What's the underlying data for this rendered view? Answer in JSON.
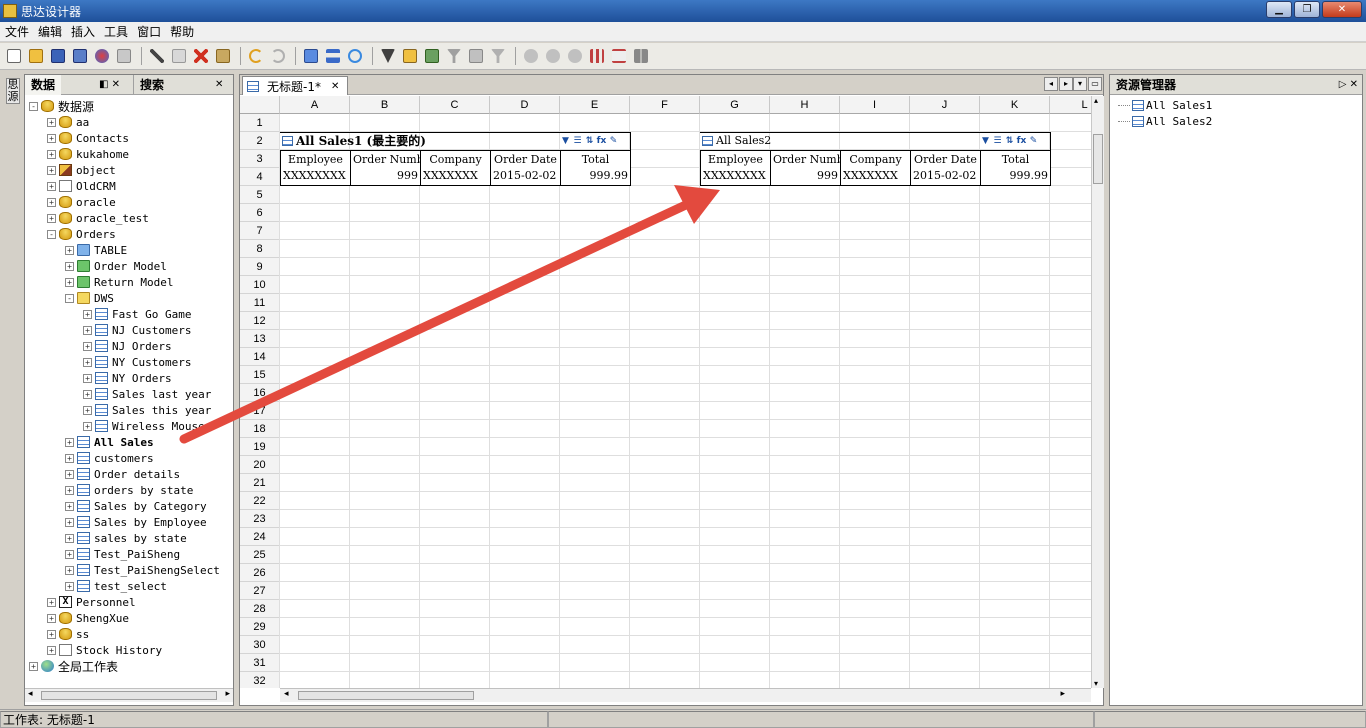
{
  "window": {
    "title": "思达设计器"
  },
  "menu": [
    "文件",
    "编辑",
    "插入",
    "工具",
    "窗口",
    "帮助"
  ],
  "left_vertical_tab": "思源",
  "left_panel": {
    "tabs": [
      "数据",
      "搜索"
    ],
    "tree": [
      {
        "label": "数据源",
        "depth": 0,
        "icon": "db",
        "exp": "-"
      },
      {
        "label": "aa",
        "depth": 1,
        "icon": "db",
        "exp": "+"
      },
      {
        "label": "Contacts",
        "depth": 1,
        "icon": "db",
        "exp": "+"
      },
      {
        "label": "kukahome",
        "depth": 1,
        "icon": "db",
        "exp": "+"
      },
      {
        "label": "object",
        "depth": 1,
        "icon": "obj",
        "exp": "+"
      },
      {
        "label": "OldCRM",
        "depth": 1,
        "icon": "crm",
        "exp": "+"
      },
      {
        "label": "oracle",
        "depth": 1,
        "icon": "db",
        "exp": "+"
      },
      {
        "label": "oracle_test",
        "depth": 1,
        "icon": "db",
        "exp": "+"
      },
      {
        "label": "Orders",
        "depth": 1,
        "icon": "db",
        "exp": "-"
      },
      {
        "label": "TABLE",
        "depth": 2,
        "icon": "folder blue",
        "exp": "+"
      },
      {
        "label": "Order Model",
        "depth": 2,
        "icon": "folder green",
        "exp": "+"
      },
      {
        "label": "Return Model",
        "depth": 2,
        "icon": "folder green",
        "exp": "+"
      },
      {
        "label": "DWS",
        "depth": 2,
        "icon": "folder",
        "exp": "-"
      },
      {
        "label": "Fast Go Game",
        "depth": 3,
        "icon": "table",
        "exp": "+"
      },
      {
        "label": "NJ Customers",
        "depth": 3,
        "icon": "table",
        "exp": "+"
      },
      {
        "label": "NJ Orders",
        "depth": 3,
        "icon": "table",
        "exp": "+"
      },
      {
        "label": "NY Customers",
        "depth": 3,
        "icon": "table",
        "exp": "+"
      },
      {
        "label": "NY Orders",
        "depth": 3,
        "icon": "table",
        "exp": "+"
      },
      {
        "label": "Sales last year",
        "depth": 3,
        "icon": "table",
        "exp": "+"
      },
      {
        "label": "Sales this year",
        "depth": 3,
        "icon": "table",
        "exp": "+"
      },
      {
        "label": "Wireless Mouse",
        "depth": 3,
        "icon": "table",
        "exp": "+"
      },
      {
        "label": "All Sales",
        "depth": 2,
        "icon": "table",
        "exp": "+",
        "bold": true
      },
      {
        "label": "customers",
        "depth": 2,
        "icon": "table",
        "exp": "+"
      },
      {
        "label": "Order details",
        "depth": 2,
        "icon": "table",
        "exp": "+"
      },
      {
        "label": "orders by state",
        "depth": 2,
        "icon": "table",
        "exp": "+"
      },
      {
        "label": "Sales by Category",
        "depth": 2,
        "icon": "table",
        "exp": "+"
      },
      {
        "label": "Sales by Employee",
        "depth": 2,
        "icon": "table",
        "exp": "+"
      },
      {
        "label": "sales by state",
        "depth": 2,
        "icon": "table",
        "exp": "+"
      },
      {
        "label": "Test_PaiSheng",
        "depth": 2,
        "icon": "table",
        "exp": "+"
      },
      {
        "label": "Test_PaiShengSelect",
        "depth": 2,
        "icon": "table",
        "exp": "+"
      },
      {
        "label": "test_select",
        "depth": 2,
        "icon": "table",
        "exp": "+"
      },
      {
        "label": "Personnel",
        "depth": 1,
        "icon": "excel",
        "exp": "+"
      },
      {
        "label": "ShengXue",
        "depth": 1,
        "icon": "db",
        "exp": "+"
      },
      {
        "label": "ss",
        "depth": 1,
        "icon": "db",
        "exp": "+"
      },
      {
        "label": "Stock History",
        "depth": 1,
        "icon": "crm",
        "exp": "+"
      },
      {
        "label": "全局工作表",
        "depth": 0,
        "icon": "globe",
        "exp": "+"
      }
    ]
  },
  "sheet": {
    "tab_label": "无标题-1*",
    "columns": [
      "A",
      "B",
      "C",
      "D",
      "E",
      "F",
      "G",
      "H",
      "I",
      "J",
      "K",
      "L"
    ],
    "row_count": 32,
    "report1": {
      "title": "All Sales1 (最主要的)",
      "headers": [
        "Employee",
        "Order Number",
        "Company",
        "Order Date",
        "Total"
      ],
      "row": [
        "XXXXXXXX",
        "999",
        "XXXXXXX",
        "2015-02-02",
        "999.99"
      ]
    },
    "report2": {
      "title": "All Sales2",
      "headers": [
        "Employee",
        "Order Number",
        "Company",
        "Order Date",
        "Total"
      ],
      "row": [
        "XXXXXXXX",
        "999",
        "XXXXXXX",
        "2015-02-02",
        "999.99"
      ]
    }
  },
  "right_panel": {
    "title": "资源管理器",
    "items": [
      "All Sales1",
      "All Sales2"
    ]
  },
  "status": {
    "text": "工作表: 无标题-1"
  }
}
